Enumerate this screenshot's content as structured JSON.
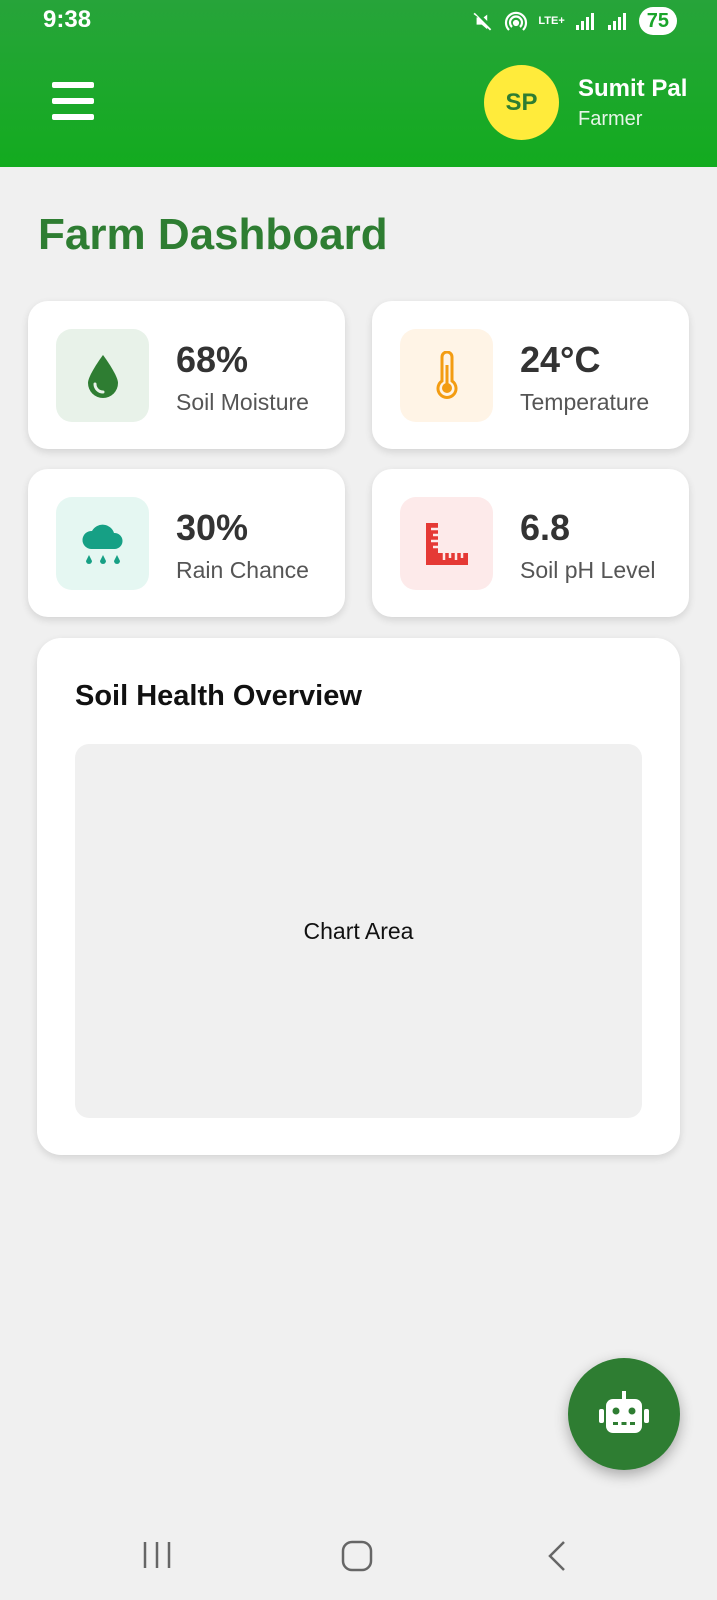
{
  "status_bar": {
    "time": "9:38",
    "network": "LTE+",
    "battery": "75"
  },
  "header": {
    "menu_icon": "hamburger-menu-icon",
    "avatar_initials": "SP",
    "user_name": "Sumit Pal",
    "user_role": "Farmer"
  },
  "page": {
    "title": "Farm Dashboard"
  },
  "stats": [
    {
      "value": "68%",
      "label": "Soil Moisture",
      "icon": "water-drop-icon",
      "accent": "#2e7d32",
      "bg": "#e8f2e9"
    },
    {
      "value": "24°C",
      "label": "Temperature",
      "icon": "thermometer-icon",
      "accent": "#f39c12",
      "bg": "#fff4e6"
    },
    {
      "value": "30%",
      "label": "Rain Chance",
      "icon": "cloud-rain-icon",
      "accent": "#16a085",
      "bg": "#e5f7f2"
    },
    {
      "value": "6.8",
      "label": "Soil pH Level",
      "icon": "ruler-combined-icon",
      "accent": "#e53935",
      "bg": "#fdeaea"
    }
  ],
  "overview": {
    "title": "Soil Health Overview",
    "placeholder": "Chart Area"
  },
  "fab": {
    "icon": "robot-icon"
  },
  "colors": {
    "header_green": "#13ab1f",
    "title_green": "#2e7d32",
    "avatar_yellow": "#ffeb3b",
    "background": "#f0f0f0"
  }
}
